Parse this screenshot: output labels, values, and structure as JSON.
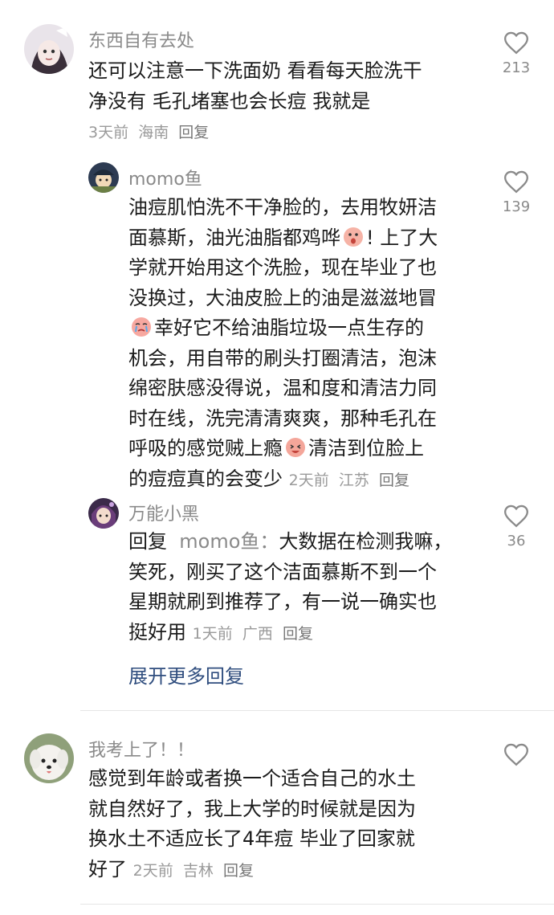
{
  "comments": [
    {
      "username": "东西自有去处",
      "lines": [
        "还可以注意一下洗面奶 看看每天脸洗干",
        "净没有 毛孔堵塞也会长痘 我就是"
      ],
      "time": "3天前",
      "location": "海南",
      "reply_label": "回复",
      "likes": "213"
    },
    {
      "username": "momo鱼",
      "lines": [
        "油痘肌怕洗不干净脸的，去用牧妍洁",
        "面慕斯，油光油脂都鸡哗",
        "! 上了大",
        "学就开始用这个洗脸，现在毕业了也",
        "没换过，大油皮脸上的油是滋滋地冒",
        "幸好它不给油脂垃圾一点生存的",
        "机会，用自带的刷头打圈清洁，泡沫",
        "绵密肤感没得说，温和度和清洁力同",
        "时在线，洗完清清爽爽，那种毛孔在",
        "呼吸的感觉贼上瘾",
        "清洁到位脸上",
        "的痘痘真的会变少"
      ],
      "time": "2天前",
      "location": "江苏",
      "reply_label": "回复",
      "likes": "139"
    },
    {
      "username": "万能小黑",
      "reply_prefix": "回复",
      "reply_to": "momo鱼：",
      "lines": [
        "大数据在检测我嘛，",
        "笑死，刚买了这个洁面慕斯不到一个",
        "星期就刷到推荐了，有一说一确实也",
        "挺好用"
      ],
      "time": "1天前",
      "location": "广西",
      "reply_label": "回复",
      "likes": "36"
    },
    {
      "username": "我考上了！！",
      "lines": [
        "感觉到年龄或者换一个适合自己的水土",
        "就自然好了，我上大学的时候就是因为",
        "换水土不适应长了4年痘 毕业了回家就",
        "好了"
      ],
      "time": "2天前",
      "location": "吉林",
      "reply_label": "回复",
      "likes": ""
    }
  ],
  "expand_label": "展开更多回复",
  "colors": {
    "text": "#1b1b1b",
    "meta": "#9a9a9a",
    "link": "#2f4d7e"
  }
}
